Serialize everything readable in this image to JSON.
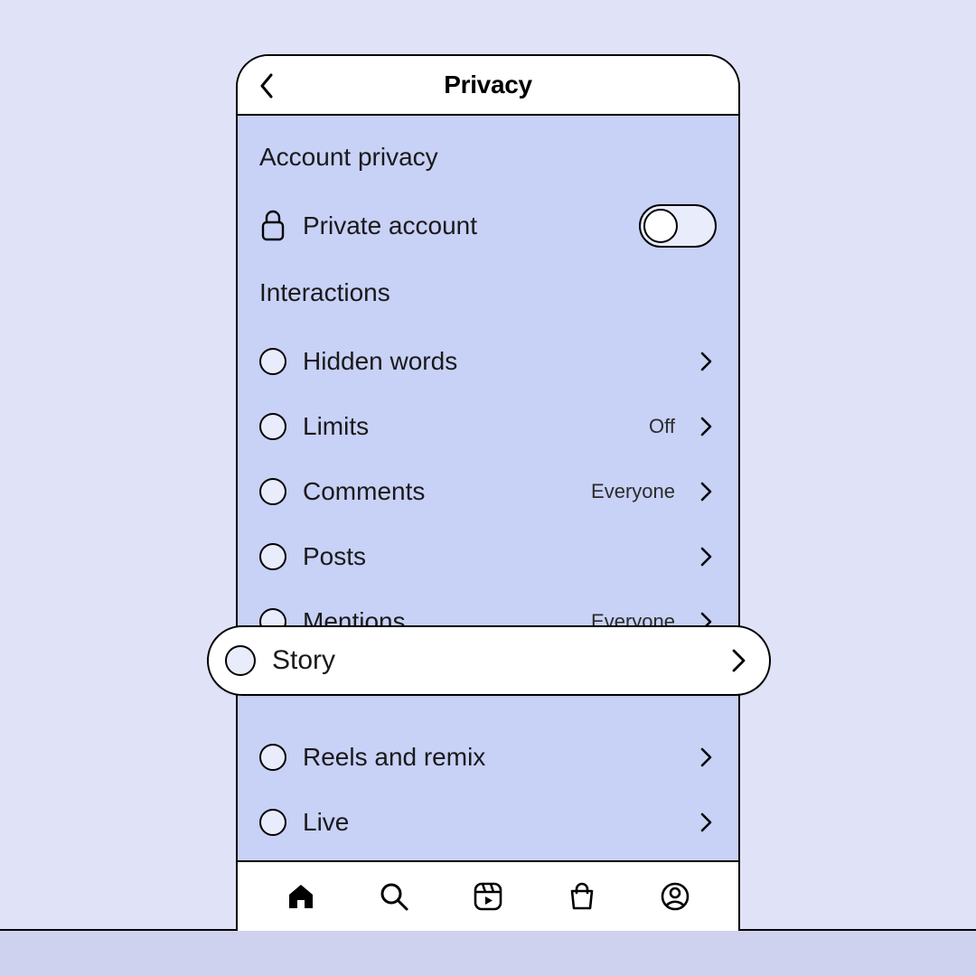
{
  "header": {
    "title": "Privacy"
  },
  "sections": {
    "account_privacy": {
      "title": "Account privacy",
      "private_account_label": "Private account",
      "private_account_on": false
    },
    "interactions": {
      "title": "Interactions",
      "items": [
        {
          "label": "Hidden words",
          "value": ""
        },
        {
          "label": "Limits",
          "value": "Off"
        },
        {
          "label": "Comments",
          "value": "Everyone"
        },
        {
          "label": "Posts",
          "value": ""
        },
        {
          "label": "Mentions",
          "value": "Everyone"
        },
        {
          "label": "Story",
          "value": "",
          "highlighted": true
        },
        {
          "label": "Reels and remix",
          "value": ""
        },
        {
          "label": "Live",
          "value": ""
        }
      ]
    }
  },
  "nav": {
    "items": [
      "home",
      "search",
      "reels",
      "shop",
      "profile"
    ]
  }
}
